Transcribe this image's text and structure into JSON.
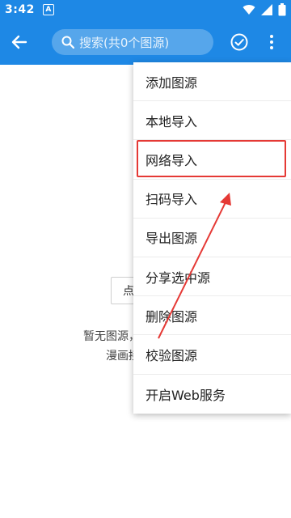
{
  "status_bar": {
    "time": "3:42",
    "notification": "A"
  },
  "app_bar": {
    "search_placeholder": "搜索(共0个图源)"
  },
  "empty_state": {
    "button_label": "点",
    "message_line1": "暂无图源，请关注微信公",
    "message_line2": "漫画接口，获取"
  },
  "menu": {
    "items": [
      "添加图源",
      "本地导入",
      "网络导入",
      "扫码导入",
      "导出图源",
      "分享选中源",
      "删除图源",
      "校验图源",
      "开启Web服务"
    ]
  },
  "colors": {
    "primary": "#1e88e5",
    "highlight": "#e53935"
  }
}
